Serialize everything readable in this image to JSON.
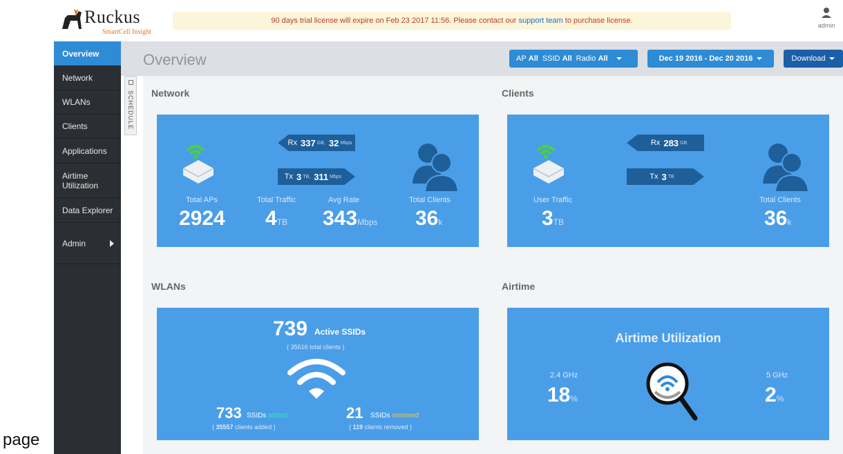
{
  "brand": {
    "name": "Ruckus",
    "product": "SmartCell Insight"
  },
  "license": {
    "text_before": "90 days trial license will expire on Feb 23 2017 11:56. Please contact our ",
    "link": "support team",
    "text_after": " to purchase license."
  },
  "user": {
    "name": "admin"
  },
  "page_label": "page",
  "sidebar": {
    "items": [
      {
        "label": "Overview",
        "active": true
      },
      {
        "label": "Network"
      },
      {
        "label": "WLANs"
      },
      {
        "label": "Clients"
      },
      {
        "label": "Applications"
      },
      {
        "label": "Airtime Utilization"
      },
      {
        "label": "Data Explorer"
      },
      {
        "label": "Admin"
      }
    ]
  },
  "schedule_tab": "SCHEDULE",
  "header": {
    "title": "Overview",
    "filter": {
      "ap_label": "AP",
      "ap_value": "All",
      "ssid_label": "SSID",
      "ssid_value": "All",
      "radio_label": "Radio",
      "radio_value": "All"
    },
    "date_range": "Dec 19 2016 - Dec 20 2016",
    "download": "Download"
  },
  "colors": {
    "accent": "#2e8bd6",
    "card": "#4a9ee8",
    "arrow": "#1e5f9a",
    "sidebar": "#2b2f33",
    "added": "#3ee0c8",
    "removed": "#f5c542"
  },
  "network": {
    "title": "Network",
    "rx": {
      "label": "Rx",
      "value1": "337",
      "unit1": "GB,",
      "value2": "32",
      "unit2": "Mbps"
    },
    "tx": {
      "label": "Tx",
      "value1": "3",
      "unit1": "TB,",
      "value2": "311",
      "unit2": "Mbps"
    },
    "total_aps": {
      "label": "Total APs",
      "value": "2924"
    },
    "total_traffic": {
      "label": "Total Traffic",
      "value": "4",
      "unit": "TB"
    },
    "avg_rate": {
      "label": "Avg Rate",
      "value": "343",
      "unit": "Mbps"
    },
    "total_clients": {
      "label": "Total Clients",
      "value": "36",
      "unit": "k"
    }
  },
  "clients": {
    "title": "Clients",
    "rx": {
      "label": "Rx",
      "value": "283",
      "unit": "GB"
    },
    "tx": {
      "label": "Tx",
      "value": "3",
      "unit": "TB"
    },
    "user_traffic": {
      "label": "User Traffic",
      "value": "3",
      "unit": "TB"
    },
    "total_clients": {
      "label": "Total Clients",
      "value": "36",
      "unit": "k"
    }
  },
  "wlans": {
    "title": "WLANs",
    "active": {
      "value": "739",
      "label": "Active SSIDs",
      "sub": "( 35616 total clients )"
    },
    "added": {
      "value": "733",
      "label": "SSIDs",
      "status": "added",
      "sub_value": "35557",
      "sub_text": " clients added )"
    },
    "removed": {
      "value": "21",
      "label": "SSIDs",
      "status": "removed",
      "sub_value": "119",
      "sub_text": " clients removed )"
    }
  },
  "airtime": {
    "title": "Airtime",
    "heading": "Airtime Utilization",
    "ghz24": {
      "label": "2.4 GHz",
      "value": "18",
      "unit": "%"
    },
    "ghz5": {
      "label": "5 GHz",
      "value": "2",
      "unit": "%"
    }
  }
}
